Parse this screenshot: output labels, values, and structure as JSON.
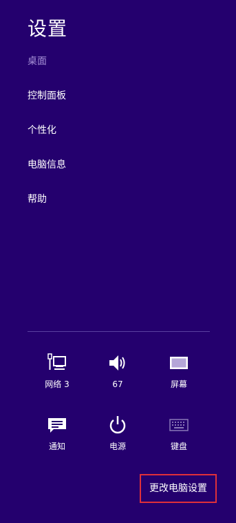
{
  "charm": {
    "title": "设置",
    "subtitle": "桌面",
    "items": [
      {
        "label": "控制面板"
      },
      {
        "label": "个性化"
      },
      {
        "label": "电脑信息"
      },
      {
        "label": "帮助"
      }
    ]
  },
  "quick_settings": [
    {
      "label": "网络 3",
      "icon": "network-icon"
    },
    {
      "label": "67",
      "icon": "volume-icon"
    },
    {
      "label": "屏幕",
      "icon": "screen-icon"
    },
    {
      "label": "通知",
      "icon": "notifications-icon"
    },
    {
      "label": "电源",
      "icon": "power-icon"
    },
    {
      "label": "键盘",
      "icon": "keyboard-icon"
    }
  ],
  "footer": {
    "change_pc_settings_label": "更改电脑设置"
  },
  "colors": {
    "background": "#24006e",
    "subtitle": "#a58fd6",
    "divider": "#5a40a0",
    "highlight_border": "#e0303a"
  }
}
